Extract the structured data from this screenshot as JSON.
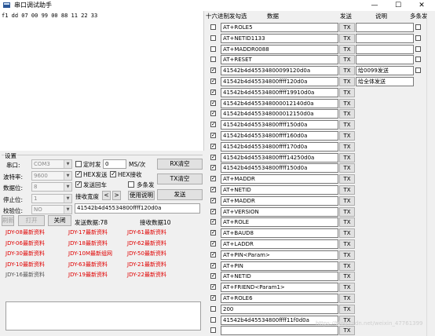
{
  "window": {
    "title": "串口调试助手",
    "minimize": "—",
    "maximize": "☐",
    "close": "✕"
  },
  "receive": {
    "text": "f1 dd 07 00 99 00 88 11 22 33"
  },
  "settings": {
    "group_title": "设置",
    "port_label": "串口:",
    "port_value": "COM3",
    "baud_label": "波特率:",
    "baud_value": "9600",
    "databits_label": "数据位:",
    "databits_value": "8",
    "stopbits_label": "停止位:",
    "stopbits_value": "1",
    "parity_label": "校验位:",
    "parity_value": "NO",
    "refresh_label": "刷新",
    "open_label": "打开",
    "close_label": "关闭",
    "timer_label": "定时发",
    "timer_value": "0",
    "timer_unit": "MS/次",
    "hex_send_label": "HEX发送",
    "hex_recv_label": "HEX接收",
    "echo_label": "发送回车",
    "multi_send_label": "多条发",
    "recv_width_label": "接收宽度",
    "prev_label": "<",
    "next_label": ">",
    "usage_label": "使用说明",
    "rx_clear_label": "RX清空",
    "tx_clear_label": "TX清空",
    "send_label": "发送",
    "send_input_value": "41542b4d45534800ffff120d0a",
    "sent_count_label": "发送数据:78",
    "recv_count_label": "接收数据10"
  },
  "links": [
    {
      "label": "JDY-08最新资料",
      "style": "red"
    },
    {
      "label": "JDY-17最新资料",
      "style": "red"
    },
    {
      "label": "JDY-61最新资料",
      "style": "red"
    },
    {
      "label": "JDY-06最新资料",
      "style": "red"
    },
    {
      "label": "JDY-18最新资料",
      "style": "red"
    },
    {
      "label": "JDY-62最新资料",
      "style": "red"
    },
    {
      "label": "JDY-30最新资料",
      "style": "red"
    },
    {
      "label": "JDY-10M最新组网",
      "style": "red"
    },
    {
      "label": "JDY-50最新资料",
      "style": "red"
    },
    {
      "label": "JDY-10最新资料",
      "style": "red"
    },
    {
      "label": "JDY-63最新资料",
      "style": "red"
    },
    {
      "label": "JDY-21最新资料",
      "style": "red"
    },
    {
      "label": "JDY-16最新资料",
      "style": "gray"
    },
    {
      "label": "JDY-19最新资料",
      "style": "red"
    },
    {
      "label": "JDY-22最新资料",
      "style": "red"
    }
  ],
  "multi": {
    "headers": {
      "hex": "十六进制发勾选",
      "data": "数据",
      "send": "发送",
      "desc": "说明",
      "multi": "多条发"
    },
    "tx_label": "TX",
    "rows": [
      {
        "checked": false,
        "data": "AT+ROLE5",
        "desc": "",
        "multi": true
      },
      {
        "checked": false,
        "data": "AT+NETID1133",
        "desc": "",
        "multi": true
      },
      {
        "checked": false,
        "data": "AT+MADDR0088",
        "desc": "",
        "multi": true
      },
      {
        "checked": false,
        "data": "AT+RESET",
        "desc": "",
        "multi": true
      },
      {
        "checked": true,
        "data": "41542b4d45534800099120d0a",
        "desc": "给0099发送",
        "multi": true
      },
      {
        "checked": true,
        "data": "41542b4d45534800ffff120d0a",
        "desc": "给全体发送",
        "multi": false
      },
      {
        "checked": true,
        "data": "41542b4d45534800ffff19910d0a",
        "desc": "",
        "multi": false
      },
      {
        "checked": true,
        "data": "41542b4d455348000012140d0a",
        "desc": "",
        "multi": false
      },
      {
        "checked": true,
        "data": "41542b4d455348000012150d0a",
        "desc": "",
        "multi": false
      },
      {
        "checked": true,
        "data": "41542b4d45534800ffff150d0a",
        "desc": "",
        "multi": false
      },
      {
        "checked": true,
        "data": "41542b4d45534800ffff160d0a",
        "desc": "",
        "multi": false
      },
      {
        "checked": true,
        "data": "41542b4d45534800ffff170d0a",
        "desc": "",
        "multi": false
      },
      {
        "checked": true,
        "data": "41542b4d45534800ffff14250d0a",
        "desc": "",
        "multi": false
      },
      {
        "checked": true,
        "data": "41542b4d45534800ffff150d0a",
        "desc": "",
        "multi": false
      },
      {
        "checked": true,
        "data": "AT+MADDR",
        "desc": "",
        "multi": false
      },
      {
        "checked": true,
        "data": "AT+NETID",
        "desc": "",
        "multi": false
      },
      {
        "checked": true,
        "data": "AT+MADDR",
        "desc": "",
        "multi": false
      },
      {
        "checked": true,
        "data": "AT+VERSION",
        "desc": "",
        "multi": false
      },
      {
        "checked": true,
        "data": "AT+ROLE",
        "desc": "",
        "multi": false
      },
      {
        "checked": true,
        "data": "AT+BAUD8",
        "desc": "",
        "multi": false
      },
      {
        "checked": true,
        "data": "AT+LADDR",
        "desc": "",
        "multi": false
      },
      {
        "checked": true,
        "data": "AT+PIN<Param>",
        "desc": "",
        "multi": false
      },
      {
        "checked": true,
        "data": "AT+PIN",
        "desc": "",
        "multi": false
      },
      {
        "checked": true,
        "data": "AT+NETID",
        "desc": "",
        "multi": false
      },
      {
        "checked": true,
        "data": "AT+FRIEND<Param1>",
        "desc": "",
        "multi": false
      },
      {
        "checked": true,
        "data": "AT+ROLE6",
        "desc": "",
        "multi": false
      },
      {
        "checked": false,
        "data": "200",
        "desc": "",
        "multi": false
      },
      {
        "checked": false,
        "data": "41542b4d45534800ffff11f0d0a",
        "desc": "",
        "multi": false
      },
      {
        "checked": false,
        "data": "",
        "desc": "",
        "multi": false
      }
    ]
  },
  "watermark": "https://blog.csdn.net/weixin_47761399"
}
